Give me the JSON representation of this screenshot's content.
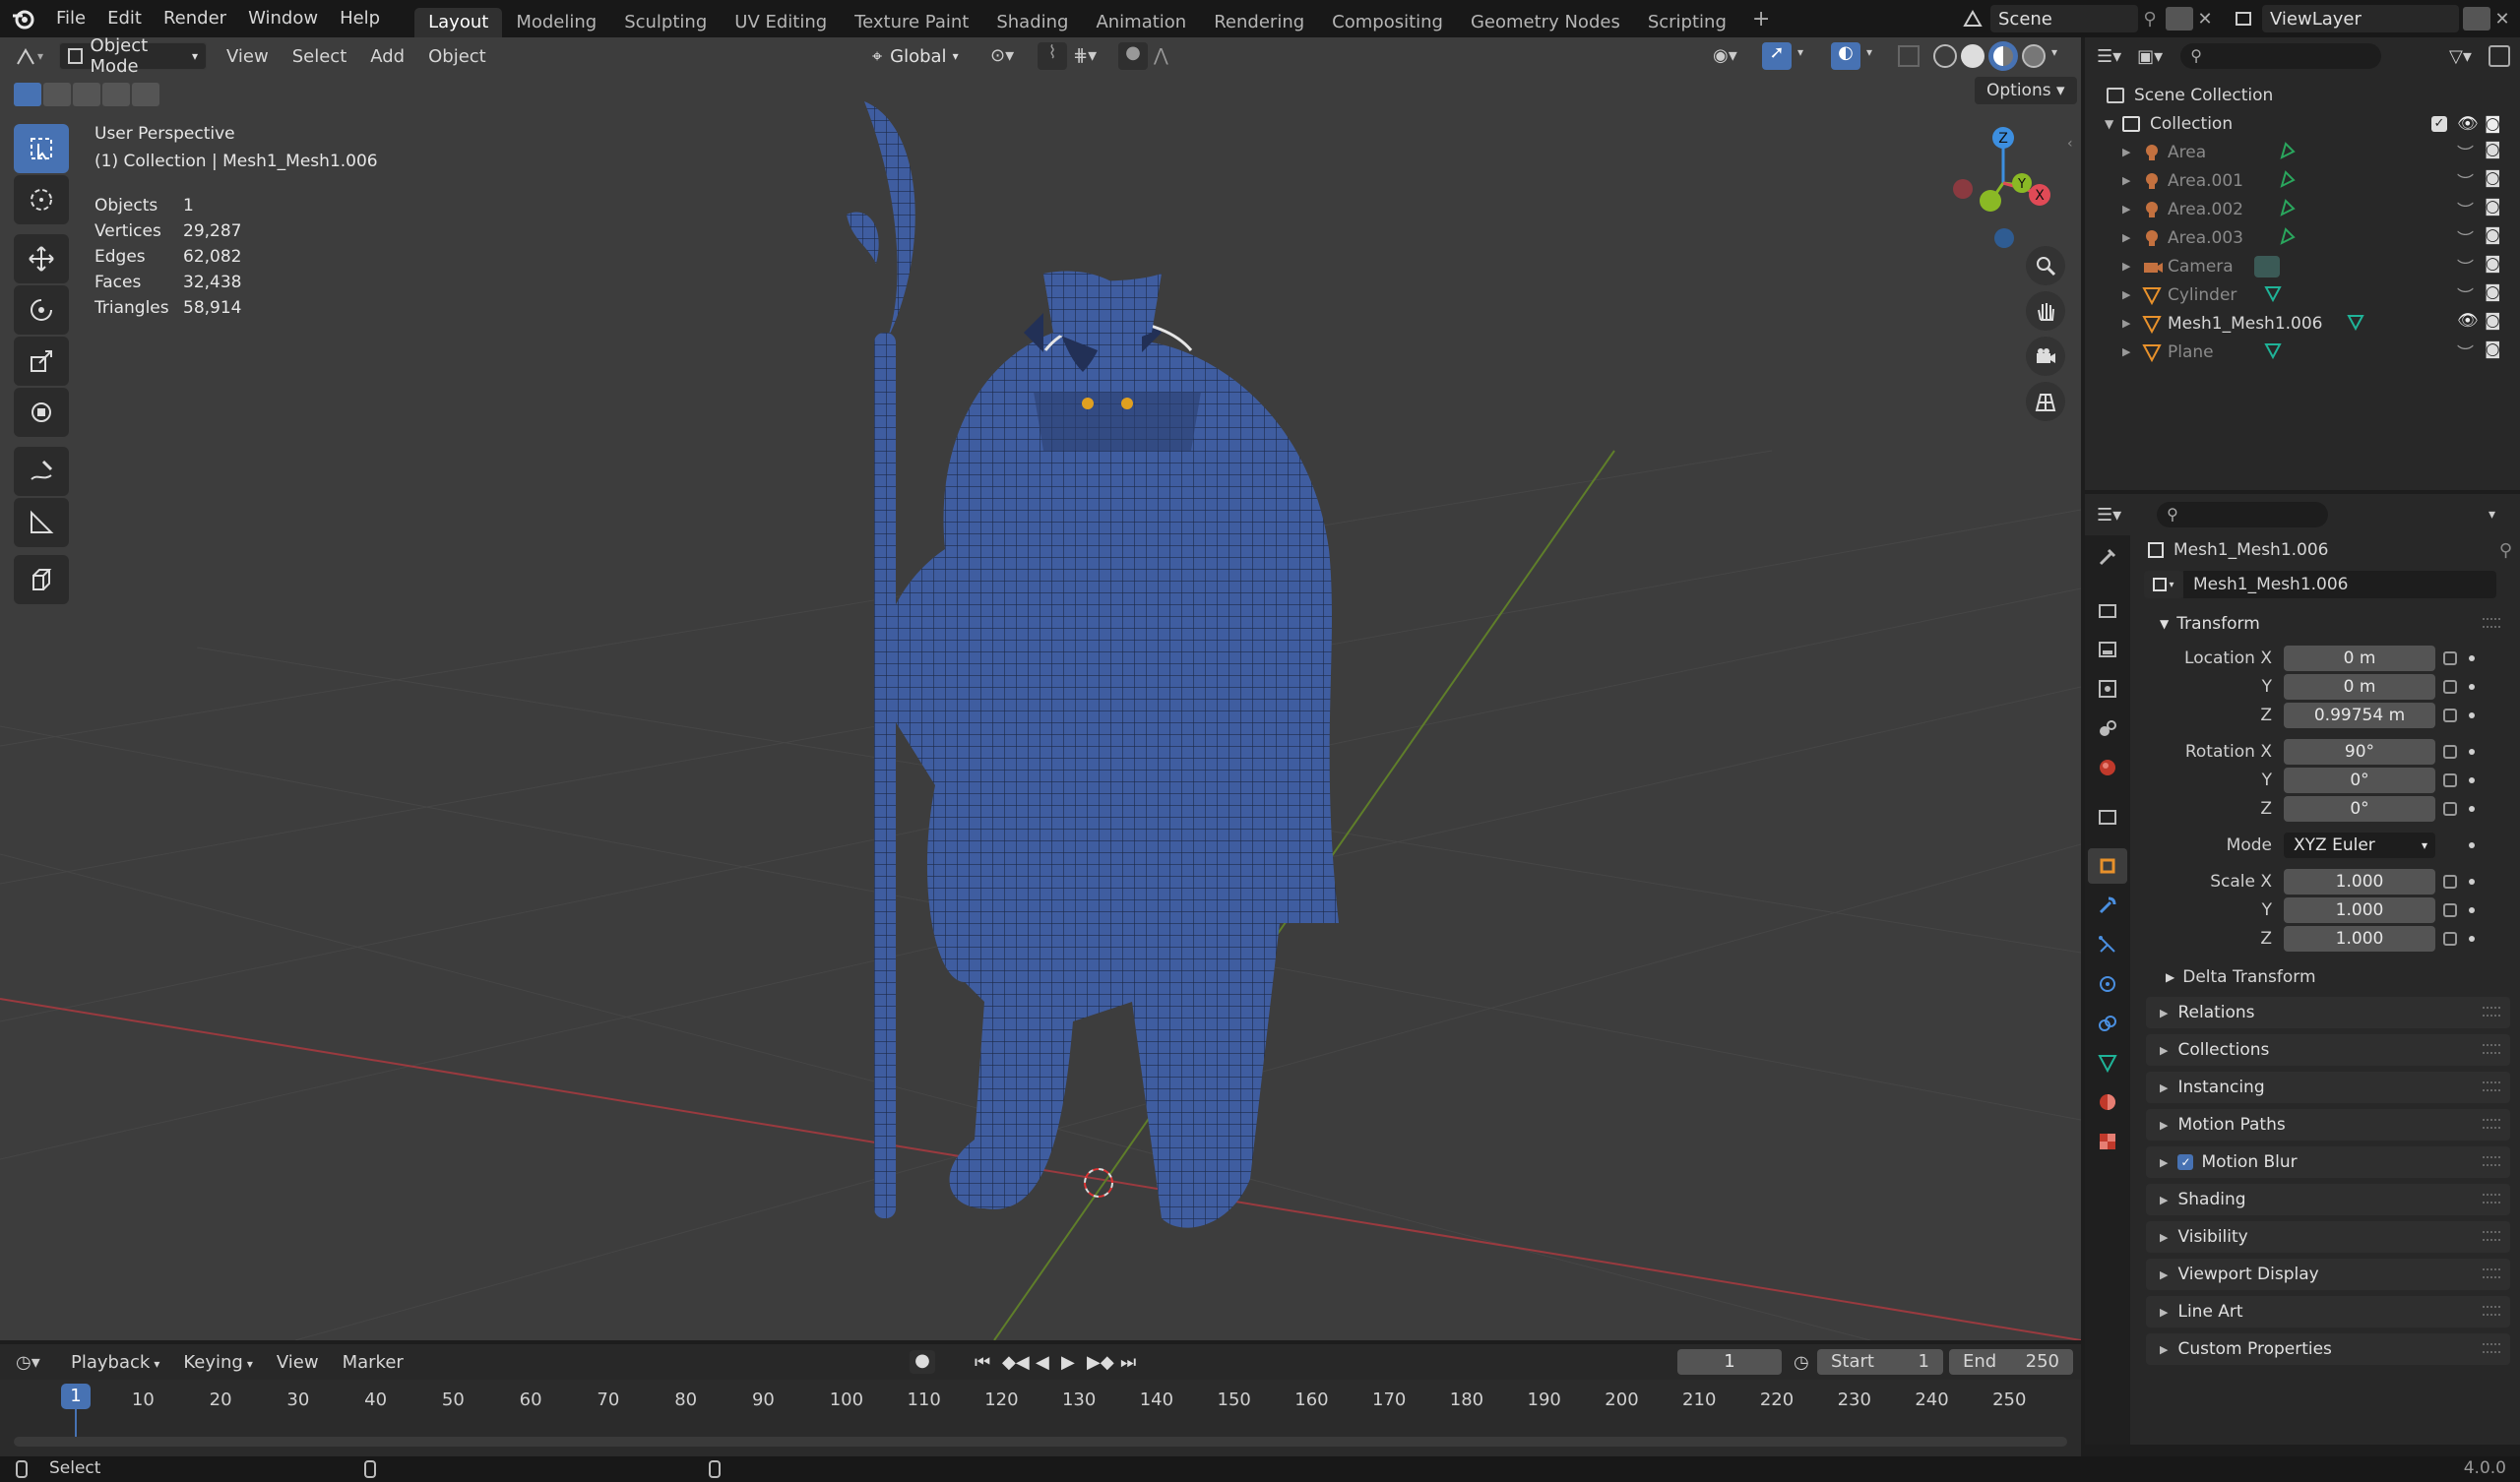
{
  "topbar": {
    "menus": [
      "File",
      "Edit",
      "Render",
      "Window",
      "Help"
    ],
    "workspaces": [
      "Layout",
      "Modeling",
      "Sculpting",
      "UV Editing",
      "Texture Paint",
      "Shading",
      "Animation",
      "Rendering",
      "Compositing",
      "Geometry Nodes",
      "Scripting"
    ],
    "active_workspace": "Layout",
    "add_tab": "+",
    "scene": "Scene",
    "view_layer": "ViewLayer"
  },
  "viewport": {
    "mode": "Object Mode",
    "menus": [
      "View",
      "Select",
      "Add",
      "Object"
    ],
    "orientation": "Global",
    "options_label": "Options",
    "view_name": "User Perspective",
    "collection_info": "(1) Collection | Mesh1_Mesh1.006",
    "stats": [
      {
        "label": "Objects",
        "value": "1"
      },
      {
        "label": "Vertices",
        "value": "29,287"
      },
      {
        "label": "Edges",
        "value": "62,082"
      },
      {
        "label": "Faces",
        "value": "32,438"
      },
      {
        "label": "Triangles",
        "value": "58,914"
      }
    ],
    "gizmo": {
      "z": "Z",
      "y": "Y",
      "x": "X"
    }
  },
  "outliner": {
    "scene_collection": "Scene Collection",
    "collection": "Collection",
    "items": [
      {
        "name": "Area",
        "type": "light",
        "dim": true
      },
      {
        "name": "Area.001",
        "type": "light",
        "dim": true
      },
      {
        "name": "Area.002",
        "type": "light",
        "dim": true
      },
      {
        "name": "Area.003",
        "type": "light",
        "dim": true
      },
      {
        "name": "Camera",
        "type": "camera",
        "dim": true
      },
      {
        "name": "Cylinder",
        "type": "mesh",
        "dim": true
      },
      {
        "name": "Mesh1_Mesh1.006",
        "type": "mesh",
        "dim": false
      },
      {
        "name": "Plane",
        "type": "mesh",
        "dim": true
      }
    ]
  },
  "properties": {
    "object_name": "Mesh1_Mesh1.006",
    "datablock_name": "Mesh1_Mesh1.006",
    "transform_title": "Transform",
    "location": {
      "label": "Location X",
      "x": "0 m",
      "y": "0 m",
      "z": "0.99754 m"
    },
    "rotation": {
      "label": "Rotation X",
      "x": "90°",
      "y": "0°",
      "z": "0°"
    },
    "mode": {
      "label": "Mode",
      "value": "XYZ Euler"
    },
    "scale": {
      "label": "Scale X",
      "x": "1.000",
      "y": "1.000",
      "z": "1.000"
    },
    "axis_y": "Y",
    "axis_z": "Z",
    "delta_transform": "Delta Transform",
    "panels": [
      "Relations",
      "Collections",
      "Instancing",
      "Motion Paths",
      "Motion Blur",
      "Shading",
      "Visibility",
      "Viewport Display",
      "Line Art",
      "Custom Properties"
    ],
    "version": "4.0.0"
  },
  "timeline": {
    "menus": [
      "Playback",
      "Keying",
      "View",
      "Marker"
    ],
    "current_frame": "1",
    "start_label": "Start",
    "start": "1",
    "end_label": "End",
    "end": "250",
    "ticks": [
      "1",
      "10",
      "20",
      "30",
      "40",
      "50",
      "60",
      "70",
      "80",
      "90",
      "100",
      "110",
      "120",
      "130",
      "140",
      "150",
      "160",
      "170",
      "180",
      "190",
      "200",
      "210",
      "220",
      "230",
      "240",
      "250"
    ]
  },
  "statusbar": {
    "select": "Select"
  },
  "colors": {
    "accent": "#4772b3",
    "x_axis": "#e04a56",
    "y_axis": "#8ab925",
    "z_axis": "#3d8fe0",
    "mesh_icon": "#1fb398"
  }
}
